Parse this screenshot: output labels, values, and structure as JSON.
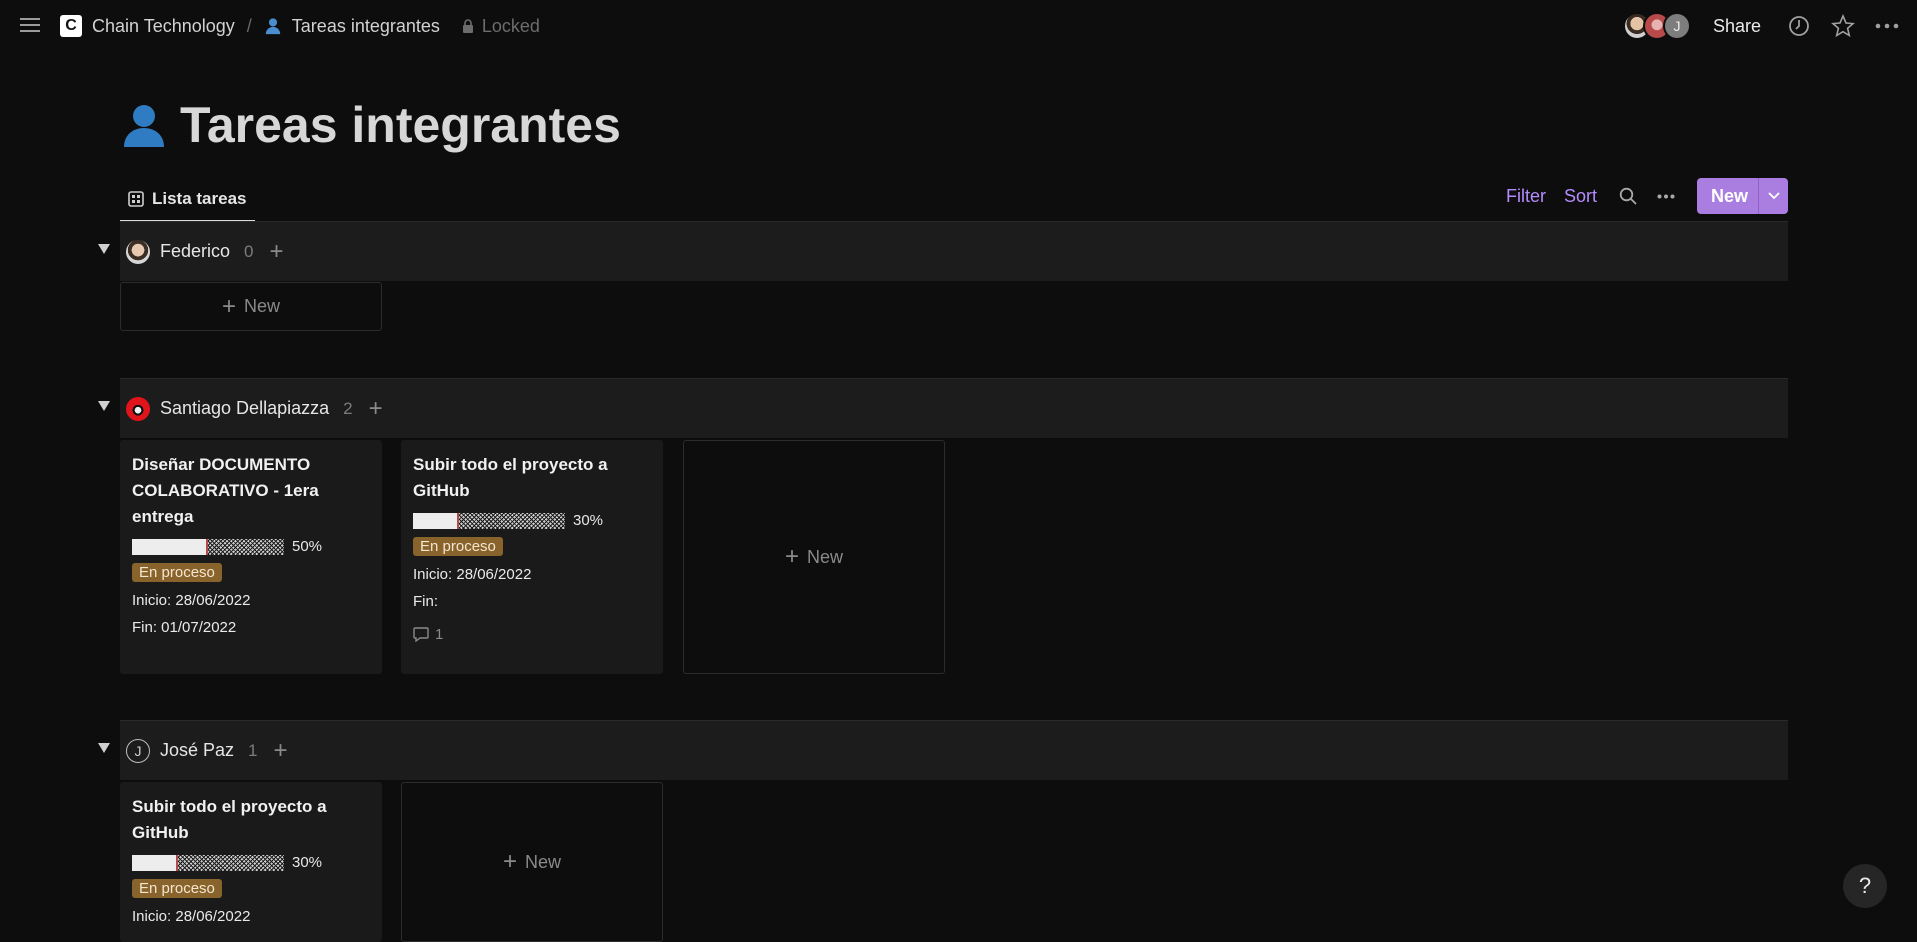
{
  "breadcrumb": {
    "workspace": "Chain Technology",
    "page": "Tareas integrantes",
    "lock_label": "Locked"
  },
  "topbar": {
    "share_label": "Share",
    "avatar_initial": "J"
  },
  "page": {
    "title": "Tareas integrantes"
  },
  "view": {
    "tab_label": "Lista tareas",
    "filter_label": "Filter",
    "sort_label": "Sort",
    "new_label": "New"
  },
  "groups": [
    {
      "name": "Federico",
      "count": "0",
      "new_label": "New",
      "cards": []
    },
    {
      "name": "Santiago Dellapiazza",
      "count": "2",
      "new_label": "New",
      "cards": [
        {
          "title": "Diseñar DOCUMENTO COLABORATIVO - 1era entrega",
          "progress": 0.5,
          "progress_label": "50%",
          "status": "En proceso",
          "start": "Inicio: 28/06/2022",
          "end": "Fin: 01/07/2022"
        },
        {
          "title": "Subir todo el proyecto a GitHub",
          "progress": 0.3,
          "progress_label": "30%",
          "status": "En proceso",
          "start": "Inicio: 28/06/2022",
          "end": "Fin:",
          "comments": "1"
        }
      ]
    },
    {
      "name": "José Paz",
      "initial": "J",
      "count": "1",
      "new_label": "New",
      "cards": [
        {
          "title": "Subir todo el proyecto a GitHub",
          "progress": 0.3,
          "progress_label": "30%",
          "status": "En proceso",
          "start": "Inicio: 28/06/2022"
        }
      ]
    }
  ],
  "help": {
    "label": "?"
  },
  "colors": {
    "accent": "#a97ee0",
    "status_bg": "#89632c",
    "background": "#0d0d0d"
  }
}
